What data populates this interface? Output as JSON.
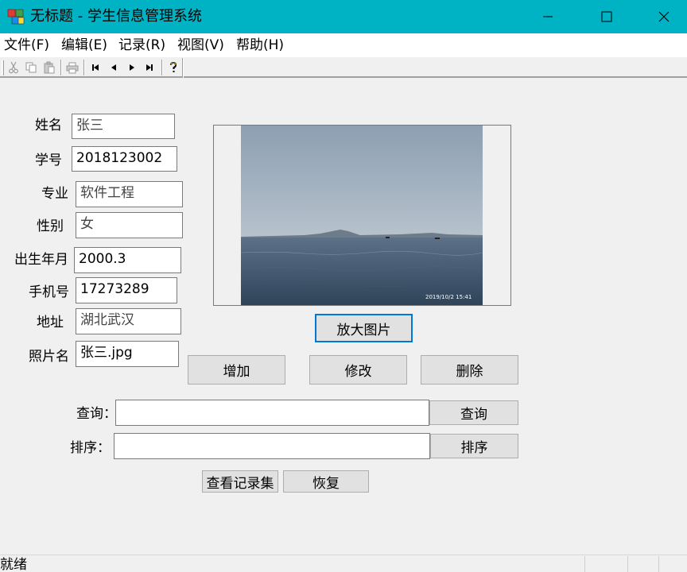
{
  "window": {
    "title": "无标题 - 学生信息管理系统",
    "colors": {
      "titlebar": "#00b3c4",
      "focus_border": "#0078d7"
    }
  },
  "menu": [
    "文件(F)",
    "编辑(E)",
    "记录(R)",
    "视图(V)",
    "帮助(H)"
  ],
  "toolbar": {
    "icons": [
      "cut-icon",
      "copy-icon",
      "paste-icon",
      "print-icon",
      "first-record-icon",
      "prev-record-icon",
      "next-record-icon",
      "last-record-icon",
      "help-icon"
    ]
  },
  "form": {
    "name": {
      "label": "姓名",
      "value": "张三"
    },
    "student_id": {
      "label": "学号",
      "value": "2018123002"
    },
    "major": {
      "label": "专业",
      "value": "软件工程"
    },
    "gender": {
      "label": "性别",
      "value": "女"
    },
    "birth": {
      "label": "出生年月",
      "value": "2000.3"
    },
    "phone": {
      "label": "手机号",
      "value": "17273289"
    },
    "address": {
      "label": "地址",
      "value": "湖北武汉"
    },
    "photo_name": {
      "label": "照片名",
      "value": "张三.jpg"
    }
  },
  "photo": {
    "timestamp": "2019/10/2  15:41"
  },
  "buttons": {
    "enlarge": "放大图片",
    "add": "增加",
    "modify": "修改",
    "delete": "删除",
    "query": "查询",
    "sort": "排序",
    "view_records": "查看记录集",
    "restore": "恢复"
  },
  "query": {
    "label": "查询：",
    "value": ""
  },
  "sort": {
    "label": "排序：",
    "value": ""
  },
  "status": {
    "text": "就绪"
  }
}
